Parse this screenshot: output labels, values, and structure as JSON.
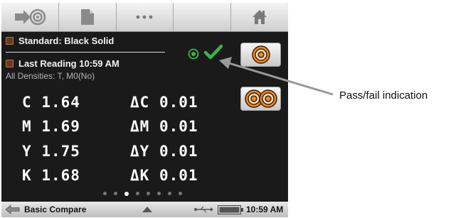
{
  "toolbar": {
    "items": [
      {
        "icon": "measure-icon"
      },
      {
        "icon": "document-icon"
      },
      {
        "icon": "more-icon"
      },
      {
        "icon": "blank"
      },
      {
        "icon": "home-icon"
      }
    ]
  },
  "info": {
    "standard_label": "Standard: Black Solid",
    "reading_label": "Last Reading 10:59 AM",
    "densities_label": "All Densities: T, M0(No)"
  },
  "readings": [
    {
      "channel": "C",
      "value": "1.64",
      "delta_label": "ΔC",
      "delta_value": "0.01"
    },
    {
      "channel": "M",
      "value": "1.69",
      "delta_label": "ΔM",
      "delta_value": "0.01"
    },
    {
      "channel": "Y",
      "value": "1.75",
      "delta_label": "ΔY",
      "delta_value": "0.01"
    },
    {
      "channel": "K",
      "value": "1.68",
      "delta_label": "ΔK",
      "delta_value": "0.01"
    }
  ],
  "pagination": {
    "count": 8,
    "active_index": 2
  },
  "status": {
    "mode_label": "Basic Compare",
    "time": "10:59 AM"
  },
  "annotation": {
    "label": "Pass/fail indication"
  },
  "colors": {
    "pass": "#39b54a",
    "accent": "#f08a24",
    "screen_bg": "#1a1a1a"
  }
}
